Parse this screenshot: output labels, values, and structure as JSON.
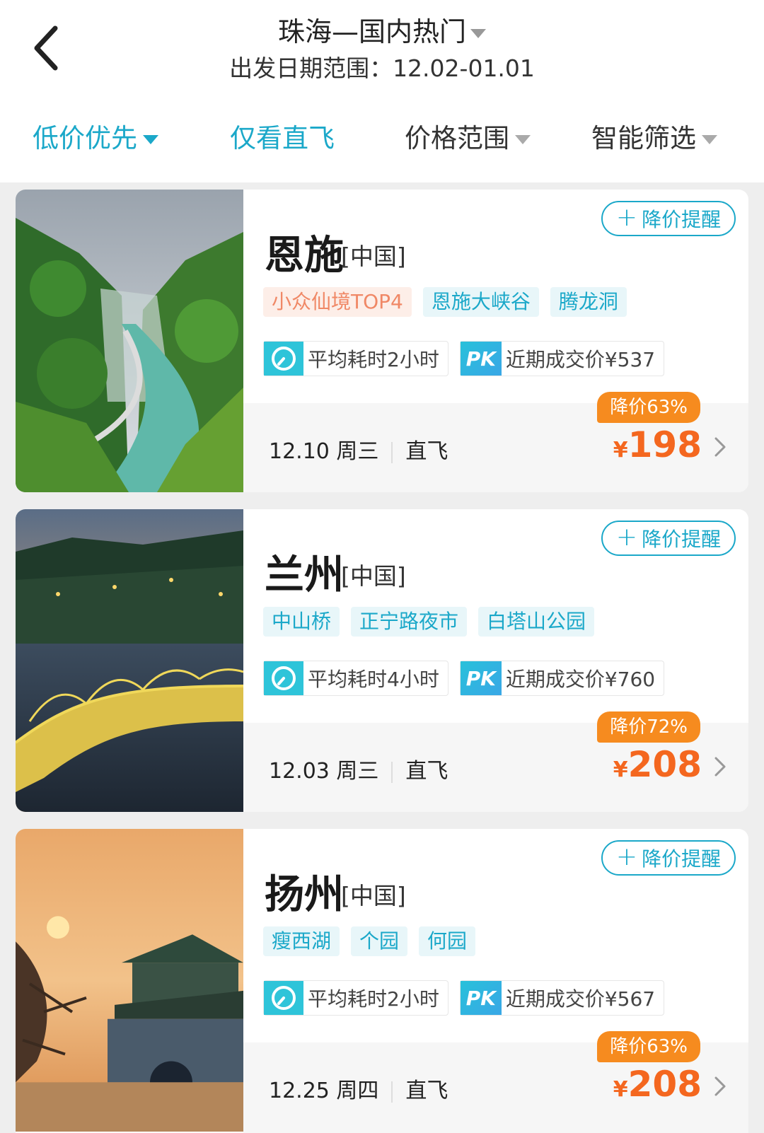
{
  "header": {
    "title": "珠海—国内热门",
    "subtitle": "出发日期范围：12.02-01.01"
  },
  "filters": [
    {
      "label": "低价优先",
      "active": true,
      "dropdown": true
    },
    {
      "label": "仅看直飞",
      "active": true,
      "dropdown": false
    },
    {
      "label": "价格范围",
      "active": false,
      "dropdown": true
    },
    {
      "label": "智能筛选",
      "active": false,
      "dropdown": true
    }
  ],
  "alert_label": "降价提醒",
  "cards": [
    {
      "city": "恩施",
      "country": "[中国]",
      "tags": [
        "小众仙境TOP4",
        "恩施大峡谷",
        "腾龙洞"
      ],
      "duration": "平均耗时2小时",
      "pk_badge": "PK",
      "recent_price": "近期成交价¥537",
      "date": "12.10 周三",
      "flight": "直飞",
      "discount": "降价63%",
      "currency": "¥",
      "price": "198"
    },
    {
      "city": "兰州",
      "country": "[中国]",
      "tags": [
        "中山桥",
        "正宁路夜市",
        "白塔山公园"
      ],
      "duration": "平均耗时4小时",
      "pk_badge": "PK",
      "recent_price": "近期成交价¥760",
      "date": "12.03 周三",
      "flight": "直飞",
      "discount": "降价72%",
      "currency": "¥",
      "price": "208"
    },
    {
      "city": "扬州",
      "country": "[中国]",
      "tags": [
        "瘦西湖",
        "个园",
        "何园"
      ],
      "duration": "平均耗时2小时",
      "pk_badge": "PK",
      "recent_price": "近期成交价¥567",
      "date": "12.25 周四",
      "flight": "直飞",
      "discount": "降价63%",
      "currency": "¥",
      "price": "208"
    }
  ],
  "colors": {
    "accent": "#1ba8c9",
    "price": "#f4671f",
    "discount_badge": "#f68b1f",
    "hot_tag_text": "#f08866"
  }
}
